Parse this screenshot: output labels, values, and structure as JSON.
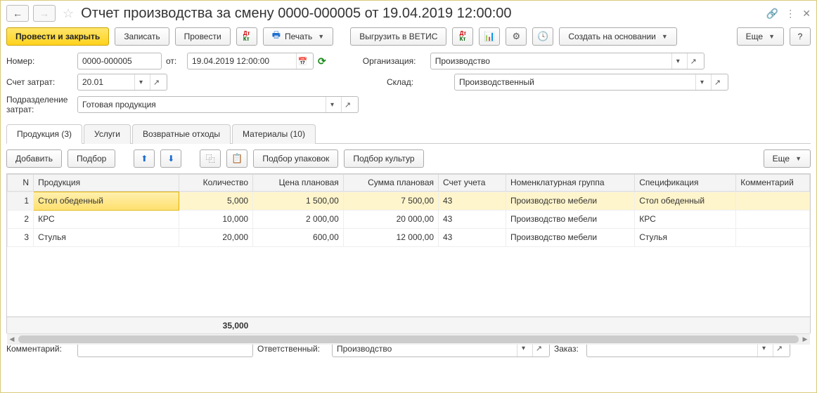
{
  "title": "Отчет производства за смену 0000-000005 от 19.04.2019 12:00:00",
  "toolbar": {
    "post_close": "Провести и закрыть",
    "save": "Записать",
    "post": "Провести",
    "print": "Печать",
    "vetis": "Выгрузить в ВЕТИС",
    "create_based": "Создать на основании",
    "more": "Еще",
    "help": "?"
  },
  "labels": {
    "number": "Номер:",
    "date_from": "от:",
    "org": "Организация:",
    "cost_account": "Счет затрат:",
    "warehouse": "Склад:",
    "cost_dept": "Подразделение затрат:",
    "comment": "Комментарий:",
    "responsible": "Ответственный:",
    "order": "Заказ:"
  },
  "fields": {
    "number": "0000-000005",
    "date": "19.04.2019 12:00:00",
    "org": "Производство",
    "cost_account": "20.01",
    "warehouse": "Производственный",
    "cost_dept": "Готовая продукция",
    "comment": "",
    "responsible": "Производство",
    "order": ""
  },
  "tabs": [
    {
      "label": "Продукция (3)",
      "active": true
    },
    {
      "label": "Услуги",
      "active": false
    },
    {
      "label": "Возвратные отходы",
      "active": false
    },
    {
      "label": "Материалы (10)",
      "active": false
    }
  ],
  "tab_toolbar": {
    "add": "Добавить",
    "pick": "Подбор",
    "pick_pack": "Подбор упаковок",
    "pick_cult": "Подбор культур",
    "more": "Еще"
  },
  "columns": {
    "n": "N",
    "product": "Продукция",
    "qty": "Количество",
    "price": "Цена плановая",
    "sum": "Сумма плановая",
    "account": "Счет учета",
    "group": "Номенклатурная группа",
    "spec": "Спецификация",
    "comment": "Комментарий"
  },
  "rows": [
    {
      "n": "1",
      "product": "Стол обеденный",
      "qty": "5,000",
      "price": "1 500,00",
      "sum": "7 500,00",
      "account": "43",
      "group": "Производство мебели",
      "spec": "Стол обеденный",
      "comment": ""
    },
    {
      "n": "2",
      "product": "КРС",
      "qty": "10,000",
      "price": "2 000,00",
      "sum": "20 000,00",
      "account": "43",
      "group": "Производство мебели",
      "spec": "КРС",
      "comment": ""
    },
    {
      "n": "3",
      "product": "Стулья",
      "qty": "20,000",
      "price": "600,00",
      "sum": "12 000,00",
      "account": "43",
      "group": "Производство мебели",
      "spec": "Стулья",
      "comment": ""
    }
  ],
  "totals": {
    "qty": "35,000"
  }
}
